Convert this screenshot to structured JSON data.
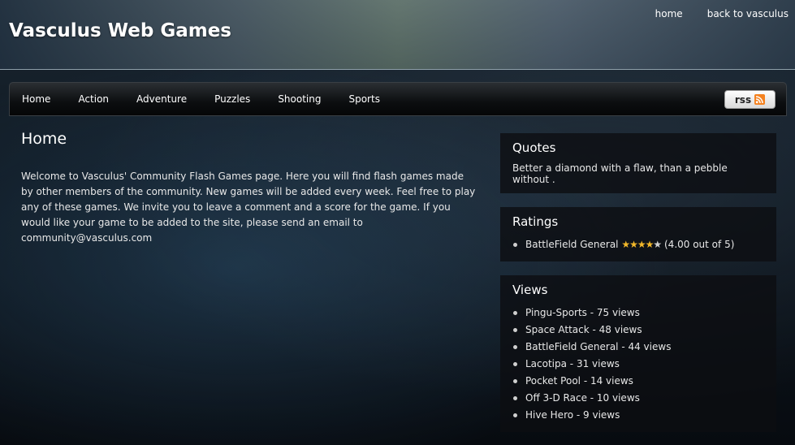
{
  "header": {
    "title": "Vasculus Web Games",
    "links": [
      "home",
      "back to vasculus"
    ]
  },
  "nav": {
    "items": [
      "Home",
      "Action",
      "Adventure",
      "Puzzles",
      "Shooting",
      "Sports"
    ],
    "rss_label": "rss"
  },
  "main": {
    "heading": "Home",
    "intro": "Welcome to Vasculus' Community Flash Games page. Here you will find flash games made by other members of the community. New games will be added every week. Feel free to play any of these games. We invite you to leave a comment and a score for the game. If you would like your game to be added to the site, please send an email to community@vasculus.com"
  },
  "sidebar": {
    "quotes": {
      "title": "Quotes",
      "text": "Better a diamond with a flaw, than a pebble without ."
    },
    "ratings": {
      "title": "Ratings",
      "items": [
        {
          "game": "BattleField General",
          "stars": 4,
          "max_stars": 5,
          "score_text": "(4.00 out of 5)"
        }
      ]
    },
    "views": {
      "title": "Views",
      "items": [
        "Pingu-Sports - 75 views",
        "Space Attack - 48 views",
        "BattleField General - 44 views",
        "Lacotipa - 31 views",
        "Pocket Pool - 14 views",
        "Off 3-D Race - 10 views",
        "Hive Hero - 9 views"
      ]
    }
  },
  "colors": {
    "rss_orange": "#f58220",
    "star_gold": "#f3b82a",
    "text_white": "#ffffff"
  }
}
